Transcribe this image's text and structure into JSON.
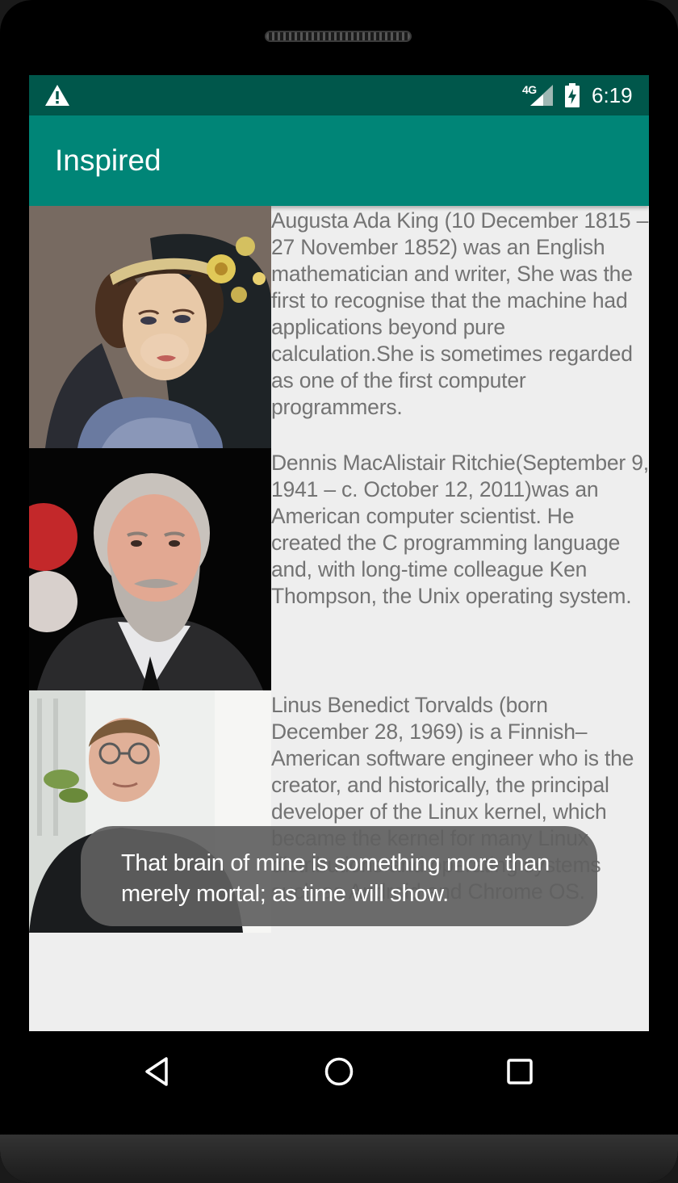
{
  "status_bar": {
    "network_label": "4G",
    "time": "6:19",
    "icons": [
      "warning-icon",
      "signal-icon",
      "battery-charging-icon"
    ]
  },
  "app_bar": {
    "title": "Inspired",
    "color": "#008577"
  },
  "list": {
    "items": [
      {
        "portrait": "ada-lovelace-portrait",
        "text": "Augusta Ada King (10 December 1815 – 27 November 1852) was an English mathematician and writer, She was the first to recognise that the machine had applications beyond pure calculation.She is sometimes regarded as one of the first computer programmers."
      },
      {
        "portrait": "dennis-ritchie-portrait",
        "text": "Dennis MacAlistair Ritchie(September 9, 1941 – c. October 12, 2011)was an American computer scientist. He created the C programming language and, with long-time colleague Ken Thompson, the Unix operating system."
      },
      {
        "portrait": "linus-torvalds-portrait",
        "text": "Linus Benedict Torvalds (born December 28, 1969) is a Finnish–American software engineer who is the creator, and historically, the principal developer of the Linux kernel, which became the kernel for many Linux distributions and operating systems such as Android and Chrome OS."
      }
    ]
  },
  "toast": {
    "message": "That brain of mine is something more than merely mortal; as time will show."
  },
  "nav_bar": {
    "buttons": [
      "back-icon",
      "home-icon",
      "recents-icon"
    ]
  }
}
